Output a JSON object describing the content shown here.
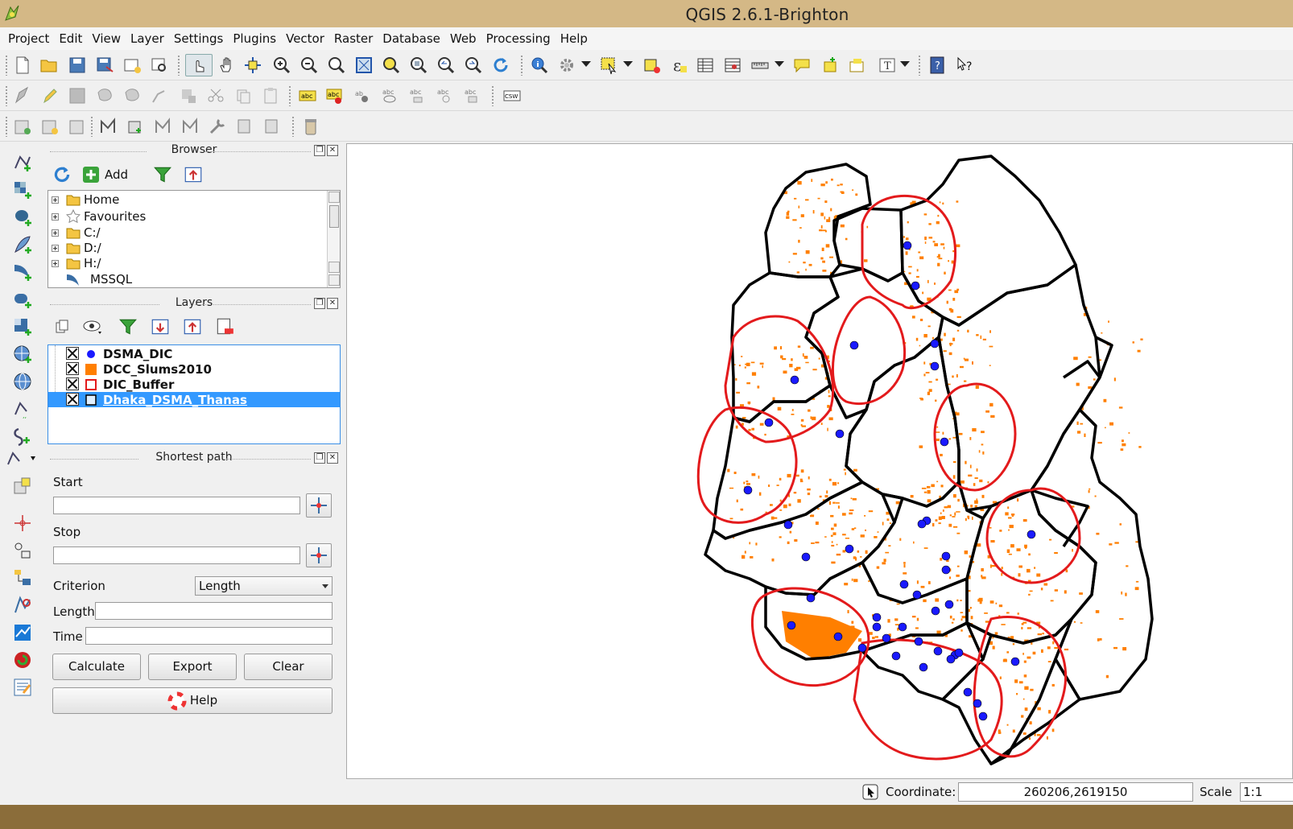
{
  "window": {
    "title": "QGIS 2.6.1-Brighton"
  },
  "menu": [
    "Project",
    "Edit",
    "View",
    "Layer",
    "Settings",
    "Plugins",
    "Vector",
    "Raster",
    "Database",
    "Web",
    "Processing",
    "Help"
  ],
  "browser": {
    "title": "Browser",
    "add_label": "Add",
    "items": [
      {
        "label": "Home",
        "icon": "folder-icon"
      },
      {
        "label": "Favourites",
        "icon": "star-icon"
      },
      {
        "label": "C:/",
        "icon": "folder-icon"
      },
      {
        "label": "D:/",
        "icon": "folder-icon"
      },
      {
        "label": "H:/",
        "icon": "folder-icon"
      },
      {
        "label": "MSSQL",
        "icon": "mssql-icon"
      }
    ]
  },
  "layers": {
    "title": "Layers",
    "items": [
      {
        "name": "DSMA_DIC",
        "symbol": "point",
        "color": "#1a1aff",
        "checked": true,
        "selected": false
      },
      {
        "name": "DCC_Slums2010",
        "symbol": "fill",
        "color": "#ff7f00",
        "checked": true,
        "selected": false
      },
      {
        "name": "DIC_Buffer",
        "symbol": "outline",
        "color": "#e31a1c",
        "checked": true,
        "selected": false
      },
      {
        "name": "Dhaka_DSMA_Thanas",
        "symbol": "outline-box",
        "color": "#000000",
        "checked": true,
        "selected": true
      }
    ]
  },
  "shortest_path": {
    "title": "Shortest path",
    "start_label": "Start",
    "start_value": "",
    "stop_label": "Stop",
    "stop_value": "",
    "criterion_label": "Criterion",
    "criterion_value": "Length",
    "length_label": "Length",
    "length_value": "",
    "time_label": "Time",
    "time_value": "",
    "calculate_label": "Calculate",
    "export_label": "Export",
    "clear_label": "Clear",
    "help_label": "Help"
  },
  "status": {
    "coordinate_label": "Coordinate:",
    "coordinate_value": "260206,2619150",
    "scale_label": "Scale",
    "scale_value": "1:1"
  },
  "colors": {
    "title_bar": "#d4b886",
    "thana_outline": "#000000",
    "buffer_outline": "#e31a1c",
    "slums_fill": "#ff7f00",
    "dic_points": "#1a1aff",
    "selection": "#3399ff"
  }
}
